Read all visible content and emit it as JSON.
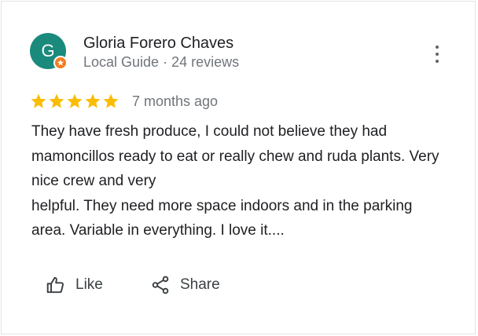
{
  "reviewer": {
    "initial": "G",
    "name": "Gloria Forero Chaves",
    "meta": "Local Guide · 24 reviews",
    "avatar_color": "#1a8a7c",
    "badge_color": "#f57c1f"
  },
  "review": {
    "rating": 5,
    "max_rating": 5,
    "star_color": "#fbbc04",
    "date": "7 months ago",
    "text": "They have fresh produce, I could not believe they had mamoncillos ready to eat or really chew and ruda plants. Very nice crew and very\nhelpful. They need more space indoors and in the parking area. Variable in everything. I love it...."
  },
  "actions": {
    "like_label": "Like",
    "share_label": "Share"
  },
  "icons": {
    "more": "more-vert-icon",
    "like": "thumbs-up-icon",
    "share": "share-icon",
    "badge": "local-guide-badge-icon",
    "star": "star-icon"
  }
}
